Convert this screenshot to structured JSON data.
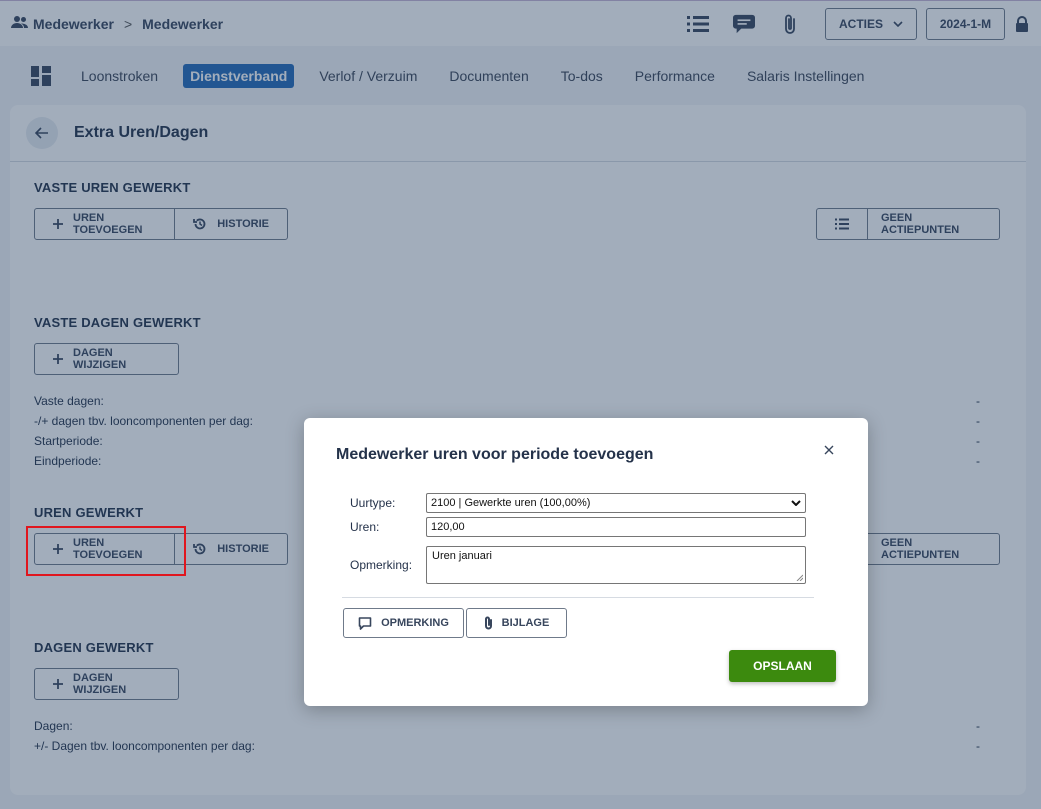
{
  "breadcrumb": {
    "items": [
      "Medewerker",
      "Medewerker"
    ],
    "separator": ">"
  },
  "toolbar": {
    "acties_label": "ACTIES",
    "period_label": "2024-1-M"
  },
  "tabs": [
    "Loonstroken",
    "Dienstverband",
    "Verlof / Verzuim",
    "Documenten",
    "To-dos",
    "Performance",
    "Salaris Instellingen"
  ],
  "active_tab": "Dienstverband",
  "page": {
    "title": "Extra Uren/Dagen"
  },
  "sections": {
    "vaste_uren": {
      "title": "VASTE UREN GEWERKT",
      "add_label": "UREN TOEVOEGEN",
      "history_label": "HISTORIE",
      "action_label": "GEEN ACTIEPUNTEN"
    },
    "vaste_dagen": {
      "title": "VASTE DAGEN GEWERKT",
      "change_label": "DAGEN WIJZIGEN",
      "fields": [
        {
          "label": "Vaste dagen:",
          "value": "-"
        },
        {
          "label": "-/+ dagen tbv. looncomponenten per dag:",
          "value": "-"
        },
        {
          "label": "Startperiode:",
          "value": "-"
        },
        {
          "label": "Eindperiode:",
          "value": "-"
        }
      ]
    },
    "uren": {
      "title": "UREN GEWERKT",
      "add_label": "UREN TOEVOEGEN",
      "history_label": "HISTORIE",
      "action_label": "GEEN ACTIEPUNTEN"
    },
    "dagen": {
      "title": "DAGEN GEWERKT",
      "change_label": "DAGEN WIJZIGEN",
      "fields": [
        {
          "label": "Dagen:",
          "value": "-"
        },
        {
          "label": "+/- Dagen tbv. looncomponenten per dag:",
          "value": "-"
        }
      ]
    }
  },
  "modal": {
    "title": "Medewerker uren voor periode toevoegen",
    "uurtype_label": "Uurtype:",
    "uurtype_value": "2100 | Gewerkte uren (100,00%)",
    "uren_label": "Uren:",
    "uren_value": "120,00",
    "opmerking_label": "Opmerking:",
    "opmerking_value": "Uren januari",
    "comment_button": "OPMERKING",
    "attachment_button": "BIJLAGE",
    "save_button": "OPSLAAN"
  },
  "colors": {
    "accent": "#236ab9",
    "save": "#3c8a0e",
    "highlight": "#e0161e",
    "overlay": "#213b5e"
  }
}
